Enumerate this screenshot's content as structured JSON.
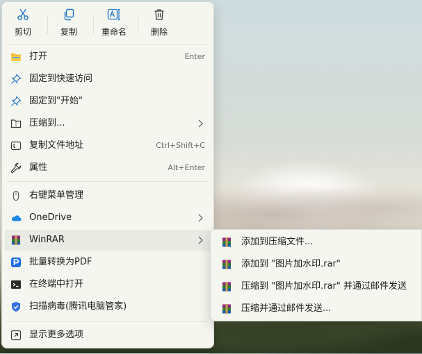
{
  "toolbar": {
    "cut": "剪切",
    "copy": "复制",
    "rename": "重命名",
    "delete": "删除"
  },
  "menu": {
    "open": {
      "label": "打开",
      "shortcut": "Enter"
    },
    "pin_quick": {
      "label": "固定到快速访问"
    },
    "pin_start": {
      "label": "固定到\"开始\""
    },
    "compress_to": {
      "label": "压缩到..."
    },
    "copy_path": {
      "label": "复制文件地址",
      "shortcut": "Ctrl+Shift+C"
    },
    "properties": {
      "label": "属性",
      "shortcut": "Alt+Enter"
    },
    "context_mgr": {
      "label": "右键菜单管理"
    },
    "onedrive": {
      "label": "OneDrive"
    },
    "winrar": {
      "label": "WinRAR"
    },
    "batch_pdf": {
      "label": "批量转换为PDF"
    },
    "terminal": {
      "label": "在终端中打开"
    },
    "scan_virus": {
      "label": "扫描病毒(腾讯电脑管家)"
    },
    "more_options": {
      "label": "显示更多选项"
    }
  },
  "winrar_submenu": [
    {
      "label": "添加到压缩文件..."
    },
    {
      "label": "添加到 \"图片加水印.rar\""
    },
    {
      "label": "压缩到 \"图片加水印.rar\" 并通过邮件发送"
    },
    {
      "label": "压缩并通过邮件发送..."
    }
  ],
  "colors": {
    "icon_blue": "#1a73c8",
    "folder_yellow": "#f2b830",
    "menu_bg": "#f5f6f0",
    "hover_bg": "#e9eae4"
  }
}
